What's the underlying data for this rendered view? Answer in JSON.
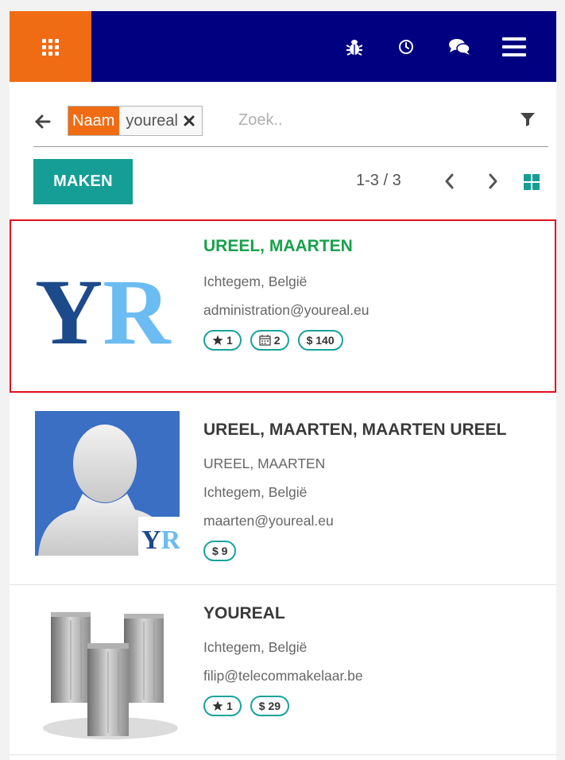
{
  "icons": {
    "apps": "apps-grid-icon",
    "debug": "bug-icon",
    "activity": "clock-icon",
    "messages": "chat-icon",
    "menu": "hamburger-menu-icon",
    "back": "arrow-left-icon",
    "filter": "filter-icon",
    "prev": "chevron-left-icon",
    "next": "chevron-right-icon",
    "kanban": "kanban-view-icon"
  },
  "colors": {
    "brand_orange": "#f06c14",
    "navbar": "#000080",
    "primary": "#159e96",
    "selected_outline": "#e2101d",
    "highlight_title": "#18a14d"
  },
  "search": {
    "facet_label": "Naam",
    "facet_value": "youreal",
    "placeholder": "Zoek.."
  },
  "toolbar": {
    "create_label": "MAKEN",
    "pager": "1-3 / 3"
  },
  "cards": [
    {
      "title": "UREEL, MAARTEN",
      "lines": [
        "Ichtegem, België",
        "administration@youreal.eu"
      ],
      "logo_text": "YR",
      "badges": [
        {
          "icon": "star-icon",
          "value": "1"
        },
        {
          "icon": "calendar-icon",
          "value": "2"
        },
        {
          "icon": "dollar-sign",
          "value": "$ 140"
        }
      ]
    },
    {
      "title": "UREEL, MAARTEN, MAARTEN UREEL",
      "lines": [
        "UREEL, MAARTEN",
        "Ichtegem, België",
        "maarten@youreal.eu"
      ],
      "logo_text": "YR",
      "badges": [
        {
          "icon": "dollar-sign",
          "value": "$ 9"
        }
      ]
    },
    {
      "title": "YOUREAL",
      "lines": [
        "Ichtegem, België",
        "filip@telecommakelaar.be"
      ],
      "badges": [
        {
          "icon": "star-icon",
          "value": "1"
        },
        {
          "icon": "dollar-sign",
          "value": "$ 29"
        }
      ]
    }
  ]
}
